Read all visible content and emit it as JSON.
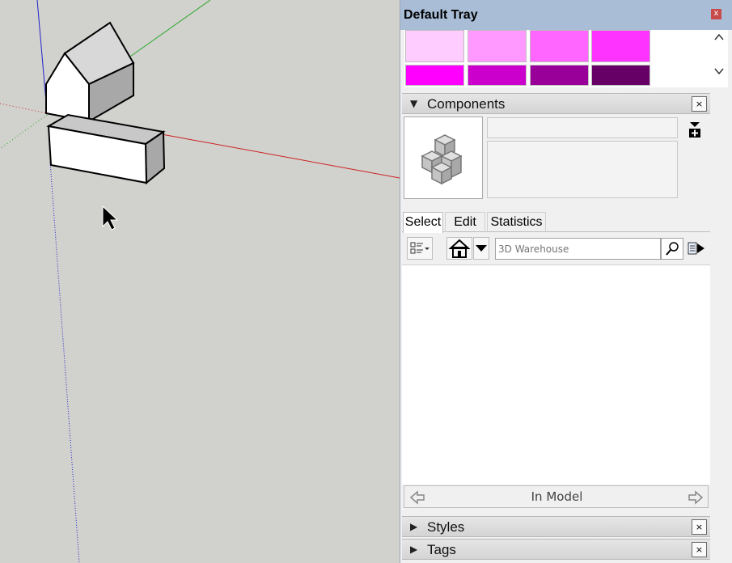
{
  "tray": {
    "title": "Default Tray",
    "close_glyph": "x"
  },
  "materials": {
    "swatch_colors": [
      "#ffccff",
      "#ff99ff",
      "#ff66ff",
      "#ff33ff",
      "#ff00ff",
      "#cc00cc",
      "#990099",
      "#660066"
    ]
  },
  "components": {
    "title": "Components",
    "close_glyph": "×",
    "tabs": [
      {
        "label": "Select"
      },
      {
        "label": "Edit"
      },
      {
        "label": "Statistics"
      }
    ],
    "search": {
      "placeholder": "3D Warehouse"
    },
    "in_model_label": "In Model"
  },
  "styles": {
    "title": "Styles",
    "close_glyph": "×"
  },
  "tags": {
    "title": "Tags",
    "close_glyph": "×"
  },
  "icons": {
    "components-preview": "cubes-icon",
    "view-options": "view-options-icon",
    "home": "home-icon",
    "search": "magnifier-icon",
    "details": "details-arrow-icon",
    "back": "back-arrow-icon",
    "forward": "forward-arrow-icon"
  }
}
